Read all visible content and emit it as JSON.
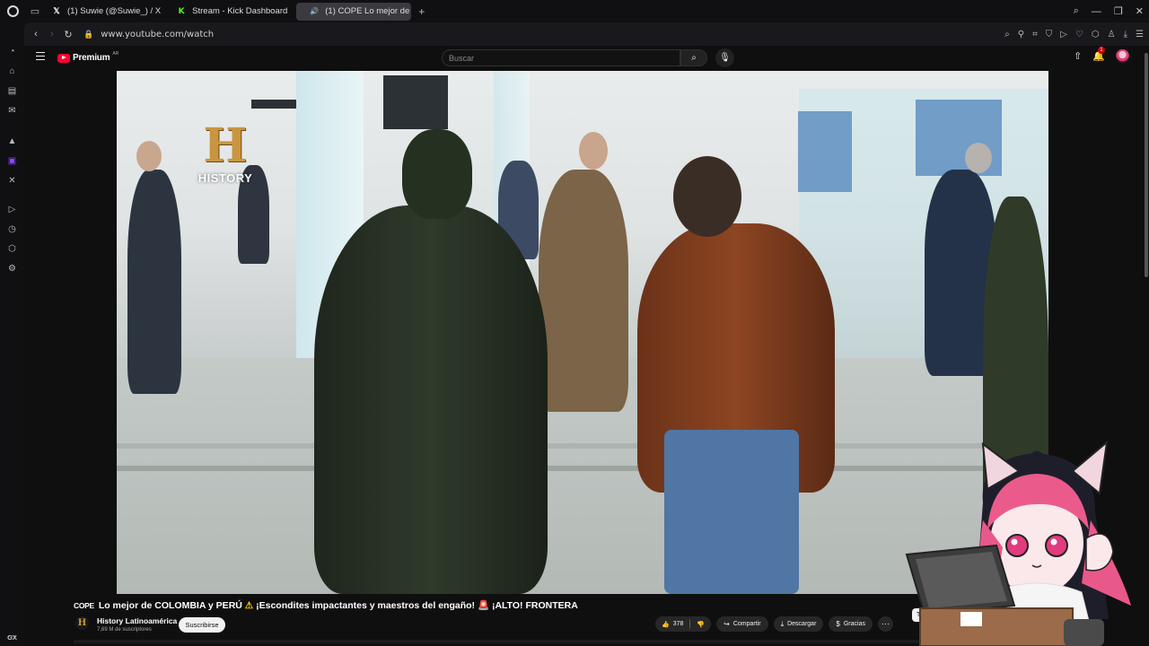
{
  "browser": {
    "tabs": [
      {
        "label": "(1) Suwie (@Suwie_) / X",
        "favicon": "x-icon"
      },
      {
        "label": "Stream - Kick Dashboard",
        "favicon": "kick-icon"
      },
      {
        "label": "(1) COPE Lo mejor de C",
        "favicon": "youtube-icon",
        "active": true,
        "audio": true
      }
    ],
    "url": "www.youtube.com/watch",
    "sidebar_label": "GX"
  },
  "youtube": {
    "logo_text": "Premium",
    "country": "AR",
    "search_placeholder": "Buscar",
    "notification_count": "1",
    "video_overlay_logo": "HISTORY",
    "title": {
      "prefix": "COPE",
      "text_1": "Lo mejor de COLOMBIA y PERÚ",
      "warn_icon": "⚠",
      "text_2": "¡Escondites impactantes y maestros del engaño!",
      "siren_icon": "🚨",
      "text_3": "¡ALTO! FRONTERA"
    },
    "channel": {
      "name": "History Latinoamérica",
      "subscribers": "7,69 M de suscriptores",
      "avatar_letter": "H"
    },
    "subscribe_label": "Suscribirse",
    "actions": {
      "likes": "378",
      "share": "Compartir",
      "download": "Descargar",
      "thanks": "Gracias"
    },
    "chip_label": "Todo"
  },
  "colors": {
    "accent": "#ff0033",
    "history_gold": "#c9953f",
    "twitch": "#9146ff",
    "kick": "#53fc18"
  }
}
